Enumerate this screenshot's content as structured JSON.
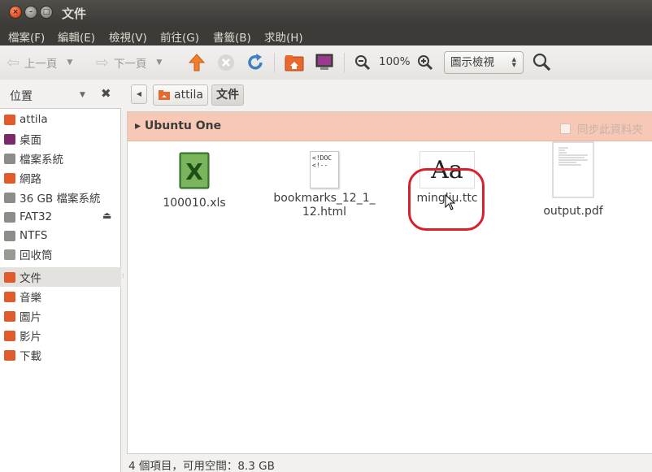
{
  "window": {
    "title": "文件",
    "close_glyph": "×",
    "min_glyph": "–",
    "max_glyph": "□"
  },
  "menubar": {
    "items": [
      {
        "label": "檔案(F)"
      },
      {
        "label": "編輯(E)"
      },
      {
        "label": "檢視(V)"
      },
      {
        "label": "前往(G)"
      },
      {
        "label": "書籤(B)"
      },
      {
        "label": "求助(H)"
      }
    ]
  },
  "toolbar": {
    "back_label": "上一頁",
    "forward_label": "下一頁",
    "zoom_level": "100%",
    "view_mode": "圖示檢視",
    "icons": {
      "up": "up-arrow-icon",
      "stop": "stop-icon",
      "reload": "reload-icon",
      "home": "home-folder-icon",
      "computer": "computer-icon",
      "zoom_out": "zoom-out-icon",
      "zoom_in": "zoom-in-icon",
      "search": "search-icon"
    }
  },
  "sidebar": {
    "header": "位置",
    "items": [
      {
        "label": "attila",
        "icon": "home-folder-icon",
        "color": "#e05a2b"
      },
      {
        "label": "桌面",
        "icon": "desktop-icon",
        "color": "#7a2a6a"
      },
      {
        "label": "檔案系統",
        "icon": "drive-icon",
        "color": "#8e8c88"
      },
      {
        "label": "網路",
        "icon": "network-icon",
        "color": "#e05a2b"
      },
      {
        "label": "36 GB 檔案系統",
        "icon": "drive-icon",
        "color": "#8e8c88"
      },
      {
        "label": "FAT32",
        "icon": "drive-icon",
        "color": "#8e8c88"
      },
      {
        "label": "NTFS",
        "icon": "drive-icon",
        "color": "#8e8c88"
      },
      {
        "label": "回收筒",
        "icon": "trash-icon",
        "color": "#9b9994"
      },
      {
        "label": "文件",
        "icon": "documents-folder-icon",
        "color": "#e05a2b"
      },
      {
        "label": "音樂",
        "icon": "music-folder-icon",
        "color": "#e05a2b"
      },
      {
        "label": "圖片",
        "icon": "pictures-folder-icon",
        "color": "#e05a2b"
      },
      {
        "label": "影片",
        "icon": "videos-folder-icon",
        "color": "#e05a2b"
      },
      {
        "label": "下載",
        "icon": "downloads-folder-icon",
        "color": "#e05a2b"
      }
    ],
    "selected_index": 8
  },
  "pathbar": {
    "crumbs": [
      {
        "label": "attila"
      },
      {
        "label": "文件"
      }
    ]
  },
  "ubuntu_one": {
    "title": "Ubuntu One",
    "sync_label": "同步此資料夾"
  },
  "files": [
    {
      "name": "100010.xls",
      "icon": "spreadsheet-icon"
    },
    {
      "name": "bookmarks_12_1_12.html",
      "name_line1": "bookmarks_12_1_",
      "name_line2": "12.html",
      "icon": "html-document-icon",
      "preview": "<!DOC\n<!--"
    },
    {
      "name": "mingliu.ttc",
      "icon": "font-file-icon",
      "preview": "Aa"
    },
    {
      "name": "output.pdf",
      "icon": "pdf-document-icon"
    }
  ],
  "status": {
    "text": "4 個項目，可用空間：8.3 GB"
  },
  "colors": {
    "accent": "#dd4814",
    "ubuntu_one_bar": "#f6c8b5",
    "highlight_ring": "#d8202a"
  }
}
